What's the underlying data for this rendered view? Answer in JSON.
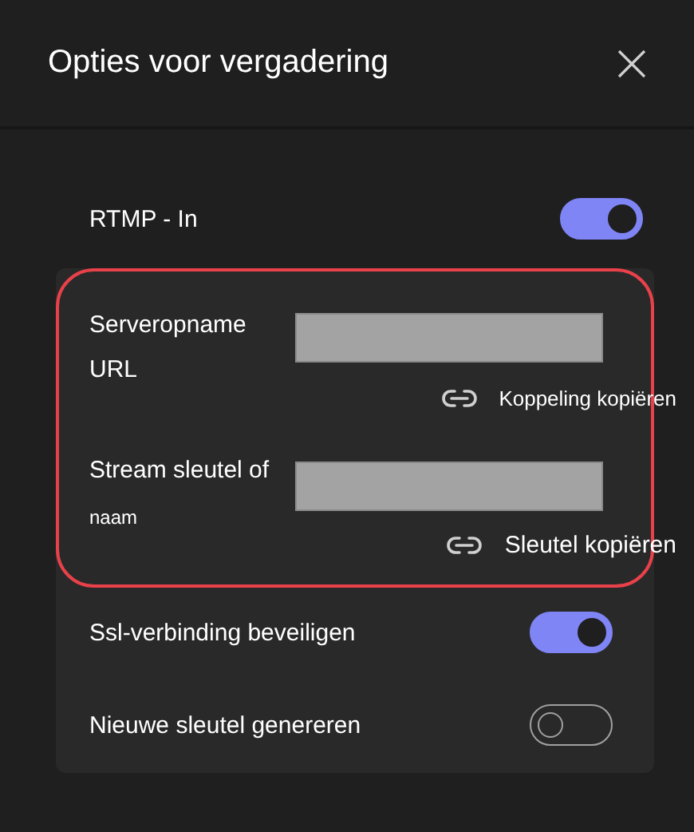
{
  "dialog": {
    "title": "Opties voor vergadering"
  },
  "rtmp_in": {
    "label": "RTMP - In",
    "on": true
  },
  "server_url": {
    "label_lines": [
      "Serveropname",
      "URL"
    ],
    "link": "Koppeling kopiëren"
  },
  "stream_key": {
    "label": "Stream sleutel of",
    "sublabel": "naam",
    "link": "Sleutel kopiëren"
  },
  "toggles": [
    {
      "label": "Ssl-verbinding beveiligen",
      "on": true
    },
    {
      "label": "Nieuwe sleutel genereren",
      "on": false
    }
  ]
}
